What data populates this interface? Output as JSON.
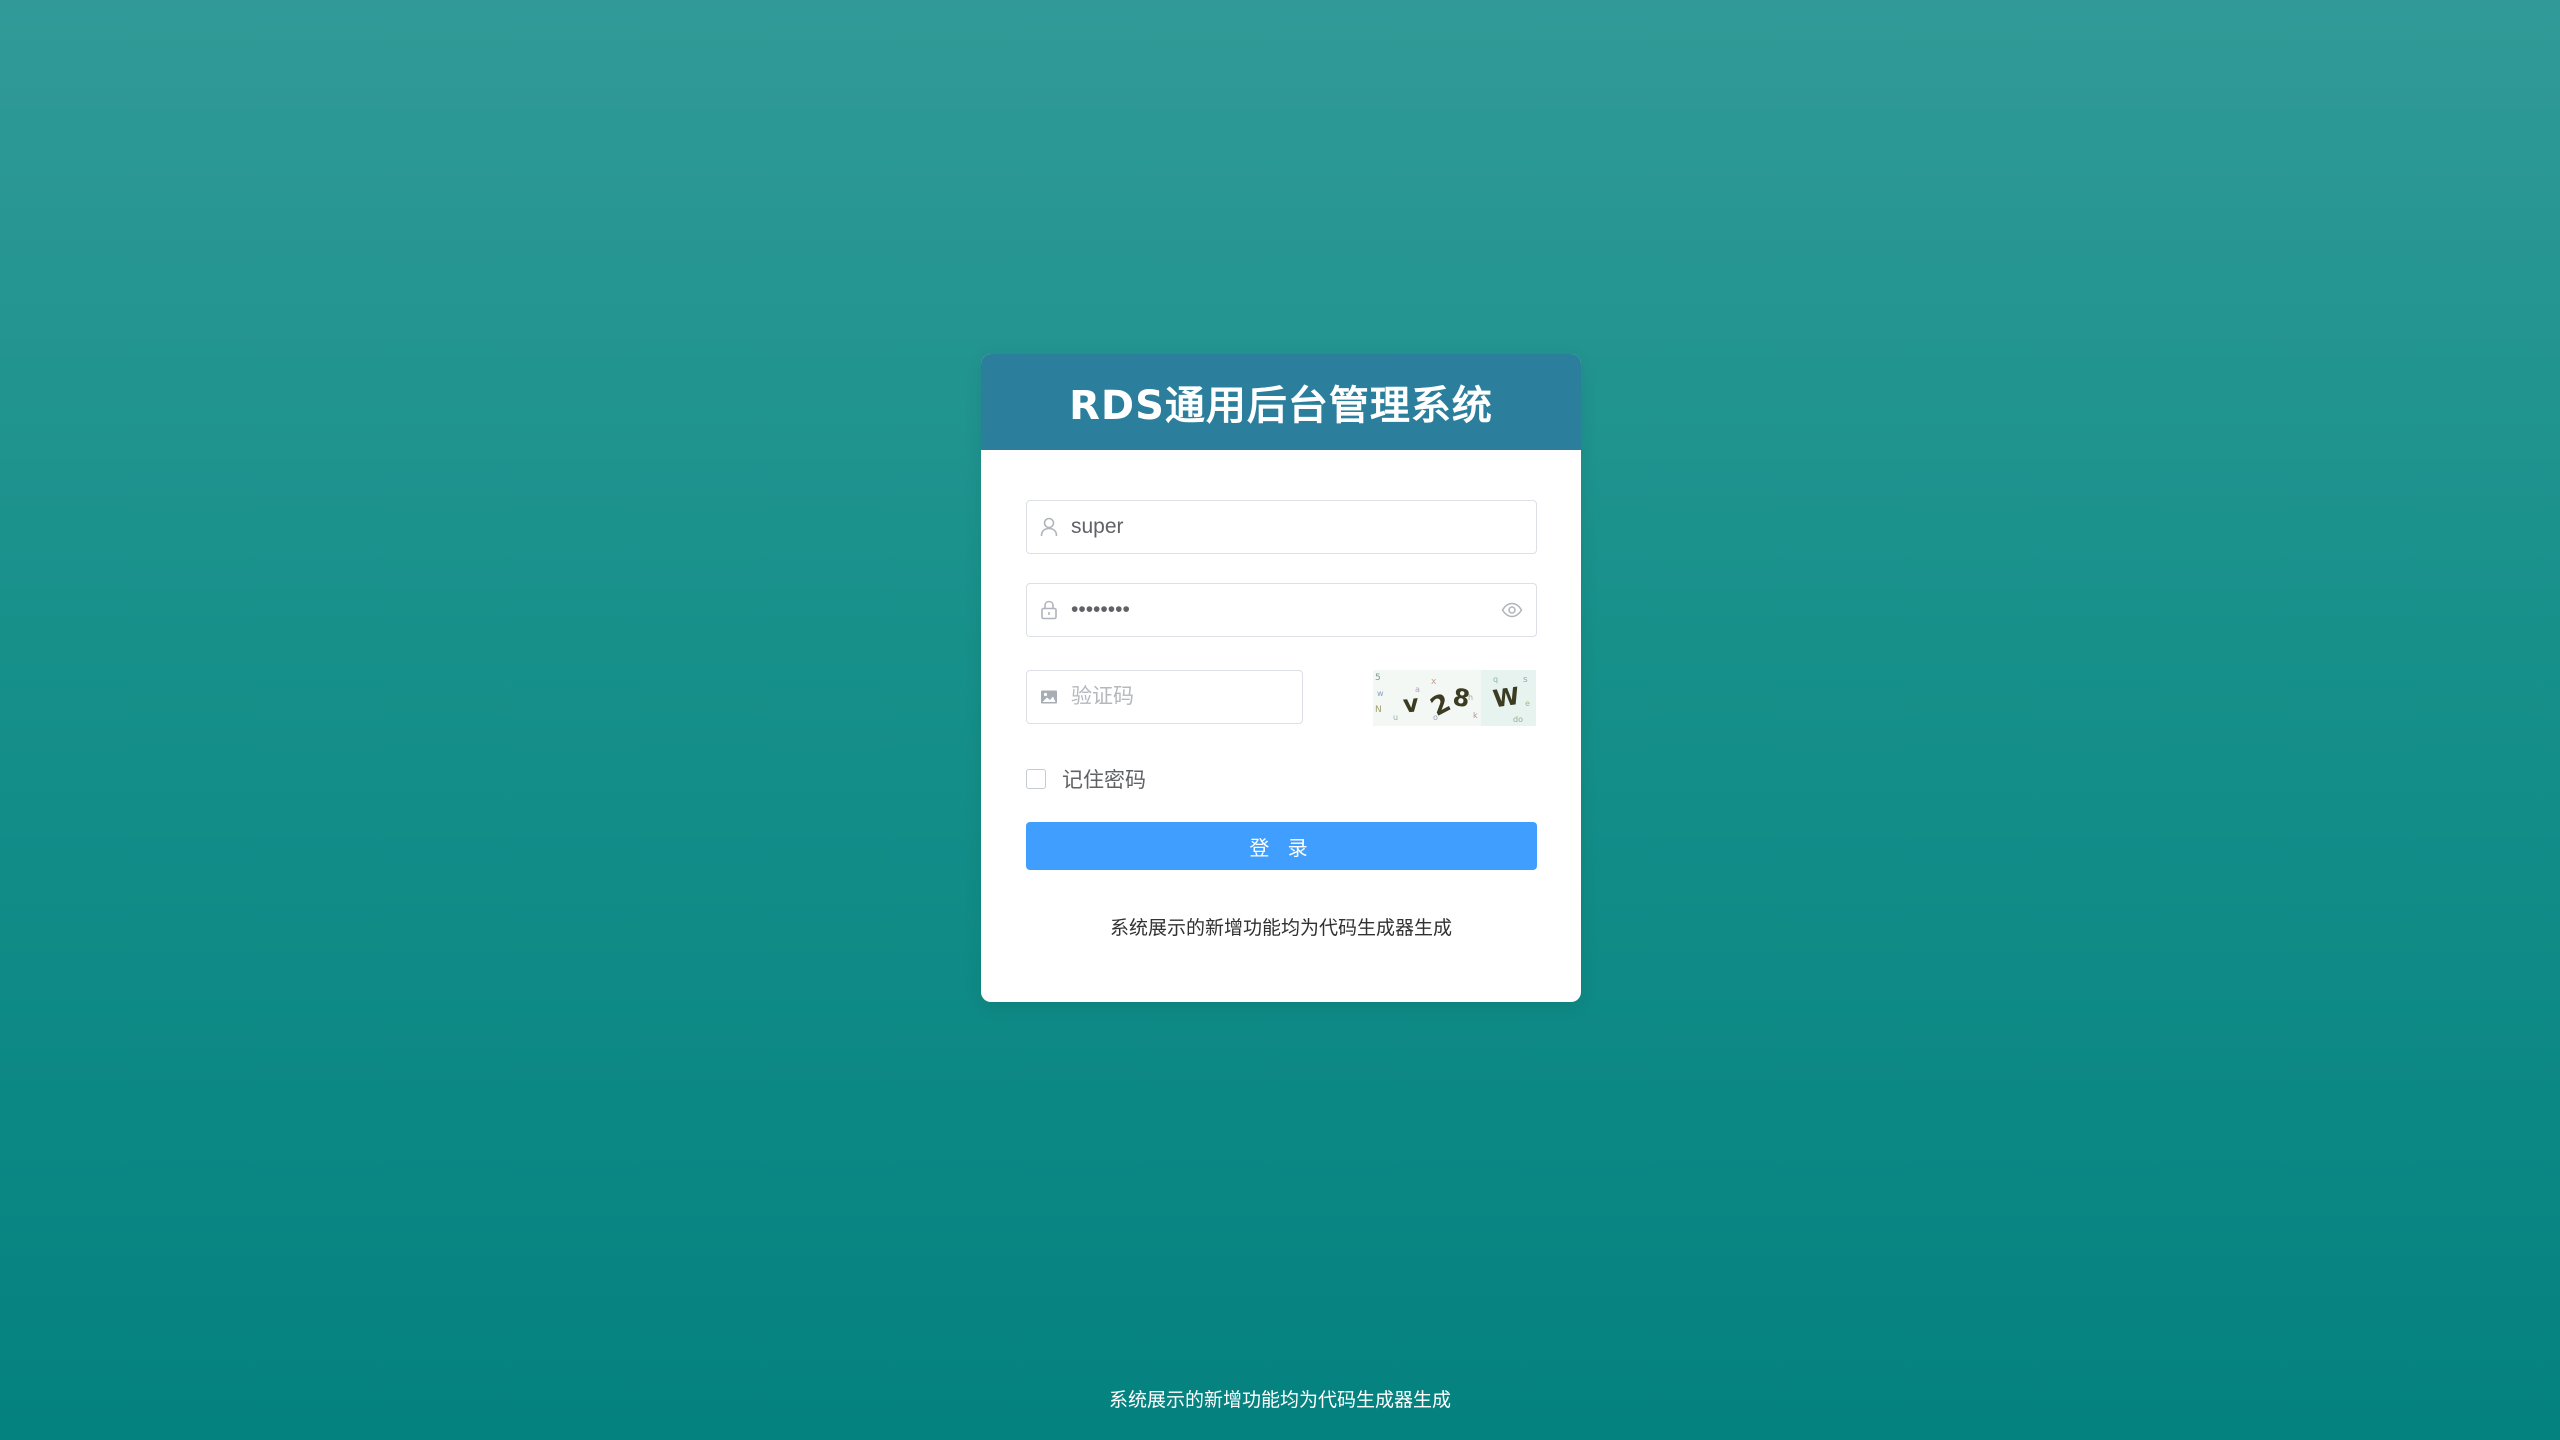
{
  "header": {
    "title": "RDS通用后台管理系统"
  },
  "form": {
    "username": {
      "value": "super",
      "icon": "user-icon"
    },
    "password": {
      "value": "••••••••",
      "icon": "lock-icon",
      "toggle_icon": "eye-icon"
    },
    "captcha": {
      "placeholder": "验证码",
      "icon": "picture-icon",
      "image_text": "v28W"
    },
    "remember_label": "记住密码",
    "remember_checked": false,
    "submit_label": "登 录"
  },
  "card_note": "系统展示的新增功能均为代码生成器生成",
  "footer": {
    "text": "系统展示的新增功能均为代码生成器生成"
  },
  "colors": {
    "header_bg": "#2b7f9c",
    "primary_button": "#409eff",
    "background_top": "#319a98",
    "background_bottom": "#048280"
  }
}
